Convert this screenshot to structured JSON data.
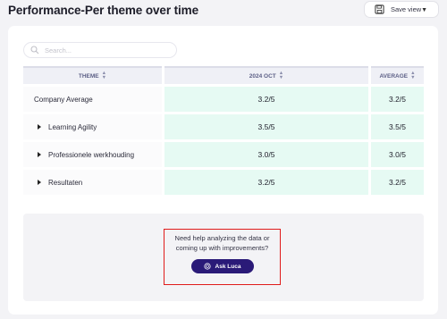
{
  "page": {
    "title": "Performance-Per theme over time"
  },
  "toolbar": {
    "save_view_label": "Save view",
    "save_icon": "floppy-disk-icon",
    "dropdown_icon": "caret-down-icon"
  },
  "search": {
    "placeholder": "Search...",
    "value": ""
  },
  "table": {
    "columns": [
      {
        "label": "THEME",
        "sort_icon": "sort-icon"
      },
      {
        "label": "2024 OCT",
        "sort_icon": "sort-icon"
      },
      {
        "label": "AVERAGE",
        "sort_icon": "sort-icon"
      }
    ],
    "rows": [
      {
        "theme": "Company Average",
        "oct_2024": "3.2/5",
        "average": "3.2/5",
        "expandable": false
      },
      {
        "theme": "Learning Agility",
        "oct_2024": "3.5/5",
        "average": "3.5/5",
        "expandable": true
      },
      {
        "theme": "Professionele werkhouding",
        "oct_2024": "3.0/5",
        "average": "3.0/5",
        "expandable": true
      },
      {
        "theme": "Resultaten",
        "oct_2024": "3.2/5",
        "average": "3.2/5",
        "expandable": true
      }
    ]
  },
  "help": {
    "line1": "Need help analyzing the data or",
    "line2": "coming up with improvements?",
    "button_label": "Ask Luca",
    "button_icon": "luca-assistant-icon"
  },
  "colors": {
    "accent": "#2a1a78",
    "highlight_cell": "#e6faf3",
    "callout_border": "#e01b1b"
  }
}
